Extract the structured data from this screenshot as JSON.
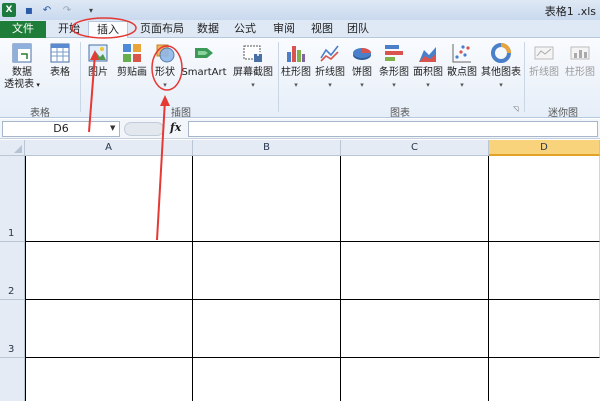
{
  "titlebar": {
    "title": "表格1 .xls"
  },
  "tabs": [
    {
      "label": "文件"
    },
    {
      "label": "开始"
    },
    {
      "label": "插入"
    },
    {
      "label": "页面布局"
    },
    {
      "label": "数据"
    },
    {
      "label": "公式"
    },
    {
      "label": "审阅"
    },
    {
      "label": "视图"
    },
    {
      "label": "团队"
    }
  ],
  "ribbon": {
    "pivot": {
      "line1": "数据",
      "line2": "透视表"
    },
    "table": "表格",
    "picture": "图片",
    "clipart": "剪贴画",
    "shapes": "形状",
    "smartart": "SmartArt",
    "screenshot": "屏幕截图",
    "column_chart": "柱形图",
    "line_chart": "折线图",
    "pie_chart": "饼图",
    "bar_chart": "条形图",
    "area_chart": "面积图",
    "scatter_chart": "散点图",
    "other_chart": "其他图表",
    "spark_line": "折线图",
    "spark_column": "柱形图",
    "groups": {
      "tables": "表格",
      "illustrations": "插图",
      "charts": "图表",
      "sparklines": "迷你图"
    }
  },
  "formula": {
    "namebox": "D6",
    "fx": "fx"
  },
  "grid": {
    "columns": [
      "A",
      "B",
      "C",
      "D"
    ],
    "rows": [
      "1",
      "2",
      "3"
    ],
    "active_column": "D"
  },
  "colors": {
    "file_tab": "#1f7d3a",
    "annotation": "#e53935",
    "active_header": "#f9d37c"
  }
}
